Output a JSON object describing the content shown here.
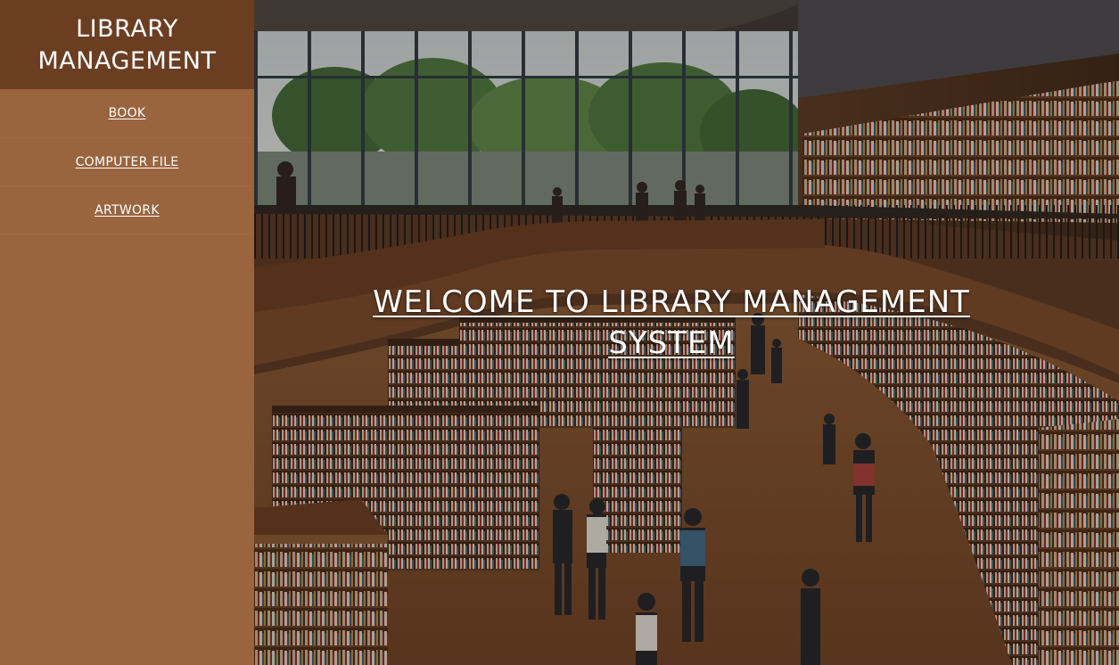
{
  "sidebar": {
    "brand_title": "LIBRARY MANAGEMENT",
    "items": [
      {
        "label": "BOOK"
      },
      {
        "label": "COMPUTER FILE"
      },
      {
        "label": "ARTWORK"
      }
    ]
  },
  "main": {
    "welcome_text": "WELCOME TO LIBRARY MANAGEMENT SYSTEM"
  },
  "colors": {
    "sidebar_bg": "#9a643f",
    "brand_bg": "#6b3e22",
    "text": "#ffffff"
  }
}
